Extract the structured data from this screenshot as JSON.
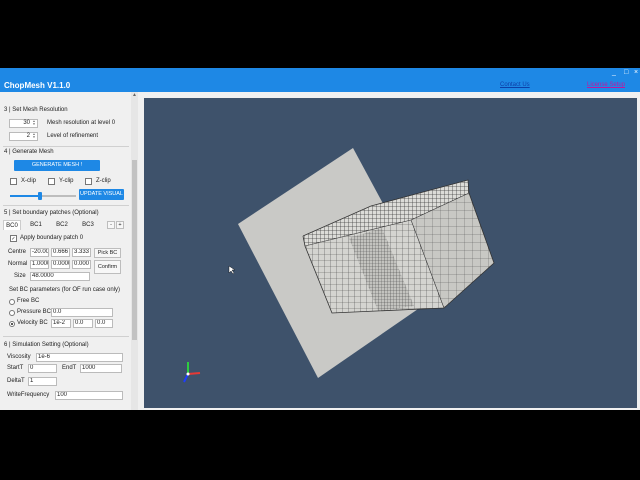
{
  "app": {
    "title": "ChopMesh V1.1.0",
    "contact_link": "Contact Us",
    "license_link": "License Setup"
  },
  "window": {
    "min": "_",
    "max": "□",
    "close": "×"
  },
  "resolution": {
    "heading": "3 | Set Mesh  Resolution",
    "level0_value": "30",
    "level0_label": "Mesh resolution at level 0",
    "refine_value": "2",
    "refine_label": "Level of refinement"
  },
  "generate": {
    "heading": "4 | Generate Mesh",
    "button": "GENERATE MESH !",
    "xclip": "X-clip",
    "yclip": "Y-clip",
    "zclip": "Z-clip",
    "slider_fraction": 0.45,
    "update_button": "UPDATE VISUAL"
  },
  "boundary": {
    "heading": "5 | Set boundary patches (Optional)",
    "tabs": [
      "BC0",
      "BC1",
      "BC2",
      "BC3"
    ],
    "add_tab": "+",
    "remove_tab": "-",
    "apply_label": "Apply boundary patch 0",
    "centre_label": "Centre",
    "centre": [
      "-20.00",
      "0.666",
      "3.333"
    ],
    "normal_label": "Normal",
    "normal": [
      "1.0000",
      "0.0000",
      "0.000"
    ],
    "size_label": "Size",
    "size": "48.0000",
    "pick_button": "Pick BC",
    "confirm_button": "Confirm",
    "params_heading": "Set BC parameters (for OF run case only)",
    "free_label": "Free BC",
    "pressure_label": "Pressure BC",
    "pressure_value": "0.0",
    "velocity_label": "Velocity BC",
    "velocity": [
      "1e-2",
      "0.0",
      "0.0"
    ]
  },
  "simulation": {
    "heading": "6 | Simulation Setting (Optional)",
    "viscosity_label": "Viscosity",
    "viscosity": "1e-6",
    "startt_label": "StartT",
    "startt": "0",
    "endt_label": "EndT",
    "endt": "1000",
    "deltat_label": "DeltaT",
    "deltat": "1",
    "writefreq_label": "WriteFrequency",
    "writefreq": "100"
  },
  "colors": {
    "accent": "#1e88e5",
    "viewport_bg": "#3e526b",
    "plane": "#c9c9c6",
    "mesh_face": "#d4d4d0",
    "mesh_line": "#4a4a4a"
  }
}
